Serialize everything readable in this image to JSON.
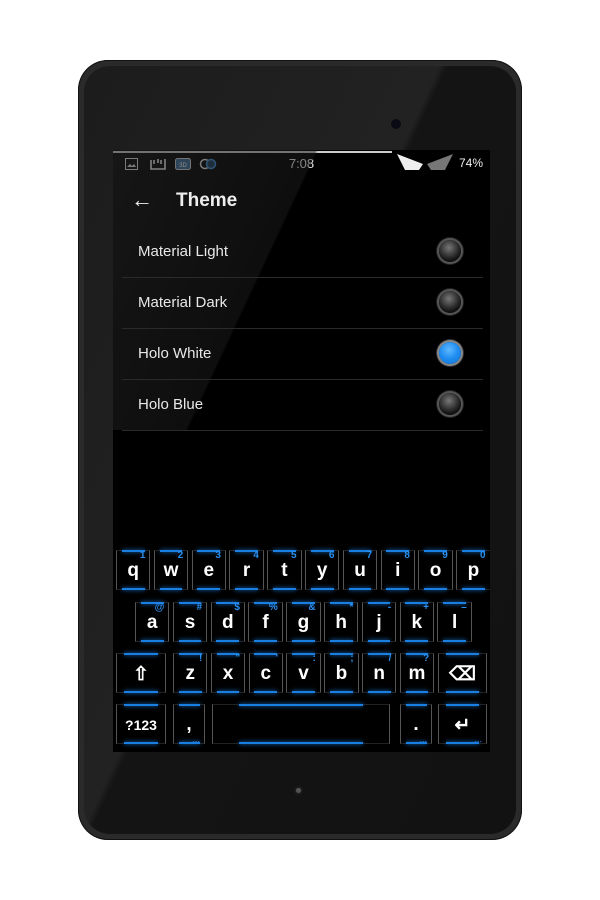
{
  "status_bar": {
    "time": "7:08",
    "battery": "74%",
    "left_icons": [
      "image-icon",
      "signal-bars-icon",
      "3d-badge-icon",
      "sync-icon"
    ],
    "right_icons": [
      "wifi-signal-icon"
    ]
  },
  "action_bar": {
    "title": "Theme",
    "back_icon": "←"
  },
  "theme_options": [
    {
      "label": "Material Light",
      "selected": false
    },
    {
      "label": "Material Dark",
      "selected": false
    },
    {
      "label": "Holo White",
      "selected": true
    },
    {
      "label": "Holo Blue",
      "selected": false
    }
  ],
  "accent_color": "#1e8cf0",
  "keyboard": {
    "row1": [
      {
        "key": "q",
        "hint": "1"
      },
      {
        "key": "w",
        "hint": "2"
      },
      {
        "key": "e",
        "hint": "3"
      },
      {
        "key": "r",
        "hint": "4"
      },
      {
        "key": "t",
        "hint": "5"
      },
      {
        "key": "y",
        "hint": "6"
      },
      {
        "key": "u",
        "hint": "7"
      },
      {
        "key": "i",
        "hint": "8"
      },
      {
        "key": "o",
        "hint": "9"
      },
      {
        "key": "p",
        "hint": "0"
      }
    ],
    "row2": [
      {
        "key": "a",
        "hint": "@"
      },
      {
        "key": "s",
        "hint": "#"
      },
      {
        "key": "d",
        "hint": "$"
      },
      {
        "key": "f",
        "hint": "%"
      },
      {
        "key": "g",
        "hint": "&"
      },
      {
        "key": "h",
        "hint": "*"
      },
      {
        "key": "j",
        "hint": "-"
      },
      {
        "key": "k",
        "hint": "+"
      },
      {
        "key": "l",
        "hint": "–"
      }
    ],
    "row3": [
      {
        "key": "z",
        "hint": "!"
      },
      {
        "key": "x",
        "hint": "\""
      },
      {
        "key": "c",
        "hint": "'"
      },
      {
        "key": "v",
        "hint": ":"
      },
      {
        "key": "b",
        "hint": ";"
      },
      {
        "key": "n",
        "hint": "/"
      },
      {
        "key": "m",
        "hint": "?"
      }
    ],
    "shift_icon": "⇧",
    "delete_icon": "⌫",
    "symbols_label": "?123",
    "comma": ",",
    "period": ".",
    "enter_icon": "↵",
    "more_dots": "..."
  }
}
